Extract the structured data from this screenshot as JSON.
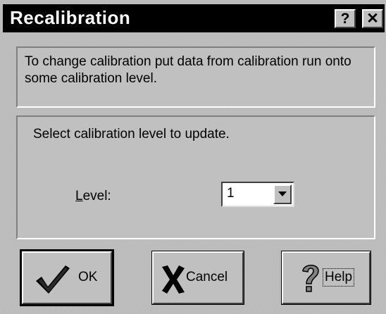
{
  "window": {
    "title": "Recalibration",
    "help_glyph": "?",
    "close_glyph": "✕"
  },
  "info": {
    "text": "To change calibration put data from calibration run onto some calibration level."
  },
  "selection": {
    "heading": "Select calibration level to update.",
    "level_label_mnemonic": "L",
    "level_label_rest": "evel:",
    "level_value": "1"
  },
  "buttons": {
    "ok_label": "OK",
    "cancel_label": "Cancel",
    "help_label": "Help"
  },
  "icons": {
    "ok": "checkmark-icon",
    "cancel": "x-cross-icon",
    "help": "question-mark-icon",
    "dropdown": "triangle-down-icon"
  },
  "colors": {
    "titlebar": "#000000",
    "face": "#c0c0c0"
  }
}
